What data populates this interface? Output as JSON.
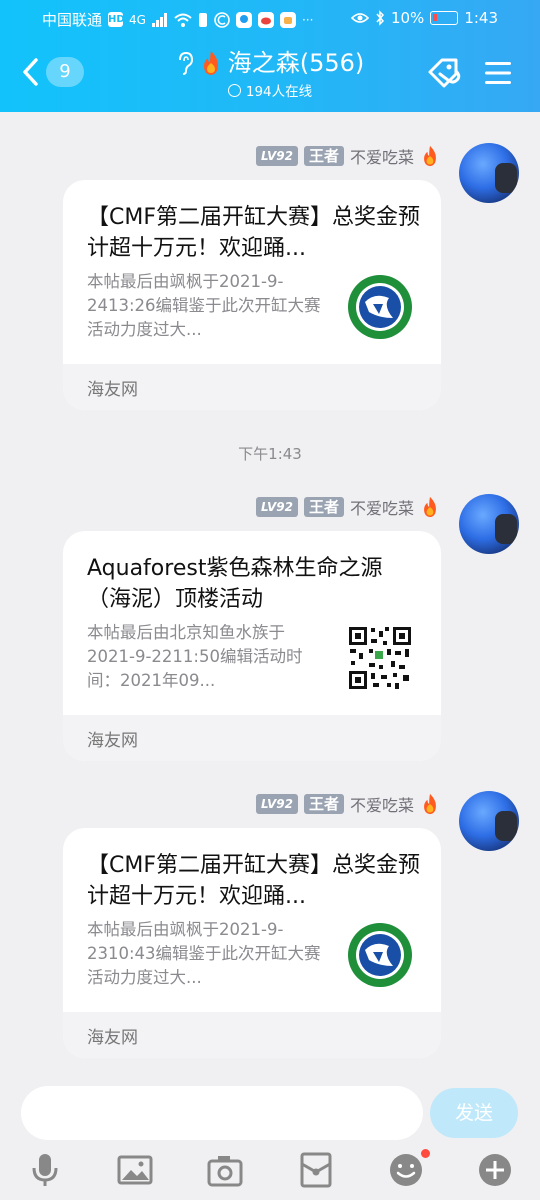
{
  "status_bar": {
    "carrier": "中国联通",
    "network_badge": "HD",
    "network_type": "4G",
    "battery_percent": "10%",
    "time": "1:43"
  },
  "header": {
    "back_count": "9",
    "group_name": "海之森(556)",
    "online": "194人在线",
    "icons": [
      "back-chevron-icon",
      "ear-icon",
      "fire-icon",
      "check-circle-icon",
      "tag-link-icon",
      "menu-icon"
    ]
  },
  "messages": [
    {
      "level": "LV92",
      "rank": "王者",
      "nickname": "不爱吃菜",
      "card": {
        "title": "【CMF第二届开缸大赛】总奖金预计超十万元！欢迎踊...",
        "desc": "本帖最后由飒枫于2021-9-2413:26编辑鉴于此次开缸大赛活动力度过大...",
        "source": "海友网",
        "thumb": "fish-logo"
      }
    },
    {
      "level": "LV92",
      "rank": "王者",
      "nickname": "不爱吃菜",
      "card": {
        "title": "Aquaforest紫色森林生命之源（海泥）顶楼活动",
        "desc": "本帖最后由北京知鱼水族于2021-9-2211:50编辑活动时间：2021年09...",
        "source": "海友网",
        "thumb": "qr-code"
      }
    },
    {
      "level": "LV92",
      "rank": "王者",
      "nickname": "不爱吃菜",
      "card": {
        "title": "【CMF第二届开缸大赛】总奖金预计超十万元！欢迎踊...",
        "desc": "本帖最后由飒枫于2021-9-2310:43编辑鉴于此次开缸大赛活动力度过大...",
        "source": "海友网",
        "thumb": "fish-logo"
      }
    }
  ],
  "timestamp": "下午1:43",
  "composer": {
    "placeholder": "",
    "send_label": "发送"
  },
  "toolbar_icons": [
    "microphone-icon",
    "image-icon",
    "camera-icon",
    "red-packet-icon",
    "emoji-icon",
    "plus-icon"
  ],
  "colors": {
    "header_start": "#12c3fb",
    "header_end": "#36a8f4",
    "send_button": "#bfe8fb",
    "notification_dot": "#ff4a3d"
  }
}
